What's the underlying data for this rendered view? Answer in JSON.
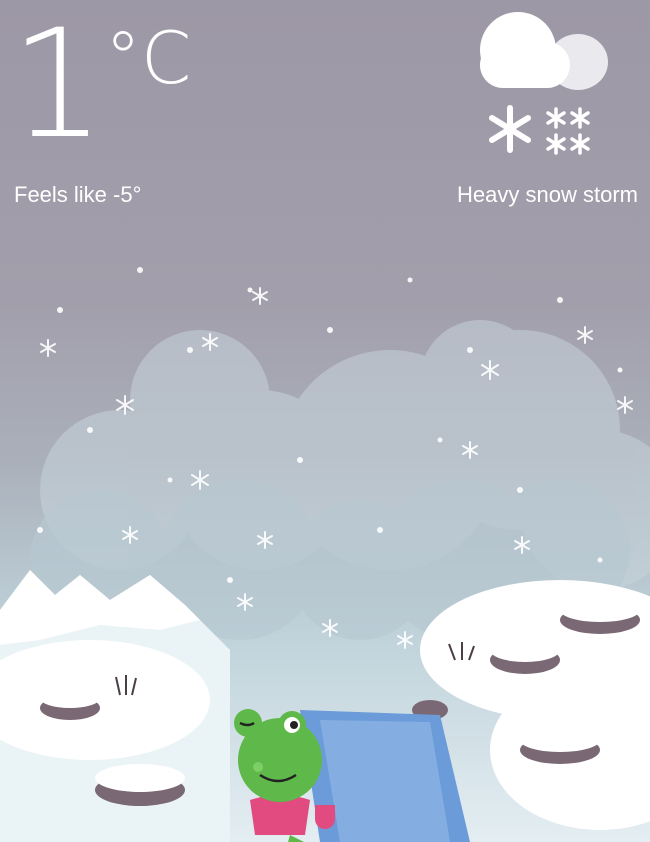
{
  "current": {
    "temperature": "1",
    "unit": "°C",
    "feels_like": "Feels like -5°",
    "condition": "Heavy snow storm"
  },
  "icons": {
    "condition_icon": "cloud-snow-icon",
    "mascot": "frog-illustration"
  },
  "colors": {
    "sky_top": "#9d98a6",
    "sky_bottom": "#bfd2da",
    "snow": "#ffffff",
    "frog": "#5fb84a",
    "scarf": "#e14b7f",
    "water": "#6b9bd8"
  }
}
